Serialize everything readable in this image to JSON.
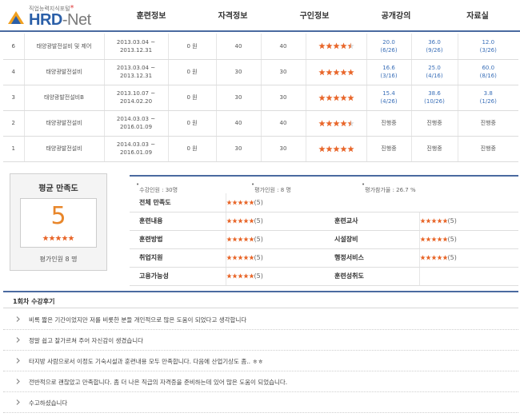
{
  "header": {
    "logo_tagline": "직업능력지식포털",
    "logo_brand": "HRD",
    "logo_net": "-Net",
    "nav": [
      "훈련정보",
      "자격정보",
      "구인정보",
      "공개강의",
      "자료실"
    ]
  },
  "courses": [
    {
      "no": "6",
      "name": "태양광발전설비 및 제어",
      "period_start": "2013.03.04 ~",
      "period_end": "2013.12.31",
      "cost": "0 원",
      "capacity": "40",
      "enrolled": "40",
      "rating": 4.5,
      "v1": "20.0",
      "v1b": "(6/26)",
      "v2": "36.0",
      "v2b": "(9/26)",
      "v3": "12.0",
      "v3b": "(3/26)"
    },
    {
      "no": "4",
      "name": "태양광발전설비",
      "period_start": "2013.03.04 ~",
      "period_end": "2013.12.31",
      "cost": "0 원",
      "capacity": "30",
      "enrolled": "30",
      "rating": 5,
      "v1": "16.6",
      "v1b": "(3/16)",
      "v2": "25.0",
      "v2b": "(4/16)",
      "v3": "60.0",
      "v3b": "(8/16)"
    },
    {
      "no": "3",
      "name": "태양광발전설비B",
      "period_start": "2013.10.07 ~",
      "period_end": "2014.02.20",
      "cost": "0 원",
      "capacity": "30",
      "enrolled": "30",
      "rating": 5,
      "v1": "15.4",
      "v1b": "(4/26)",
      "v2": "38.6",
      "v2b": "(10/26)",
      "v3": "3.8",
      "v3b": "(1/26)"
    },
    {
      "no": "2",
      "name": "태양광발전설비",
      "period_start": "2014.03.03 ~",
      "period_end": "2016.01.09",
      "cost": "0 원",
      "capacity": "40",
      "enrolled": "40",
      "rating": 4.5,
      "v1": "진행중",
      "v1b": "",
      "v2": "진행중",
      "v2b": "",
      "v3": "진행중",
      "v3b": ""
    },
    {
      "no": "1",
      "name": "태양광발전설비",
      "period_start": "2014.03.03 ~",
      "period_end": "2016.01.09",
      "cost": "0 원",
      "capacity": "30",
      "enrolled": "30",
      "rating": 5,
      "v1": "진행중",
      "v1b": "",
      "v2": "진행중",
      "v2b": "",
      "v3": "진행중",
      "v3b": ""
    }
  ],
  "satisfaction": {
    "title": "평균 만족도",
    "score": "5",
    "eval_count": "평가인원 8 명"
  },
  "summary": {
    "enrolled": "수강인원 : 30명",
    "evaluators": "평가인원 : 8 명",
    "participation": "평가참가율 : 26.7 %"
  },
  "ratings": {
    "overall_label": "전체 만족도",
    "overall_value": "(5)",
    "content_label": "훈련내용",
    "content_value": "(5)",
    "teacher_label": "훈련교사",
    "teacher_value": "(5)",
    "method_label": "훈련방법",
    "method_value": "(5)",
    "facility_label": "시설장비",
    "facility_value": "(5)",
    "employ_label": "취업지원",
    "employ_value": "(5)",
    "admin_label": "행정서비스",
    "admin_value": "(5)",
    "job_label": "고용가능성",
    "job_value": "(5)",
    "achieve_label": "훈련성취도",
    "achieve_value": ""
  },
  "reviews": {
    "title": "1회차 수강후기",
    "items": [
      "비록 짧은 기간이었지만 저를 비롯한 분들 개인적으로 많은 도움이 되었다고 생각합니다",
      "정말 쉽고 잘가르쳐 주어 자신감이 생겼습니다",
      "타지방 사람으로서 이정도 기숙시설과 훈련내용 모두 만족합니다. 다음에 산업기상도 좀.. ㅎㅎ",
      "전반적으로 괜찮았고 만족합니다. 좀 더 나은 직급의 자격증을 준비하는데 있어 많은 도움이 되었습니다.",
      "수고하셨습니다"
    ]
  },
  "colors": {
    "accent": "#4a6aa0",
    "star": "#e8662a",
    "link": "#3a6fb8",
    "score": "#e8862a"
  }
}
